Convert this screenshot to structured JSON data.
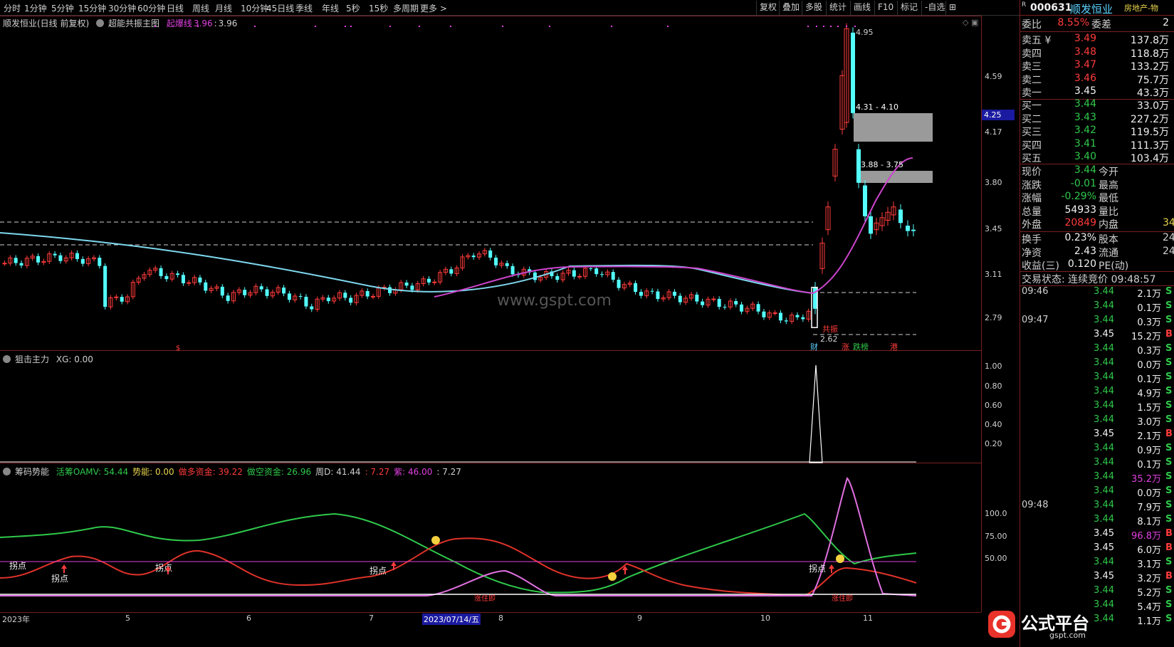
{
  "toolbar": {
    "timeframes": [
      "分时",
      "1分钟",
      "5分钟",
      "15分钟",
      "30分钟",
      "60分钟",
      "日线",
      "周线",
      "月线",
      "10分钟",
      "45日线",
      "季线",
      "年线",
      "5秒",
      "15秒",
      "多周期",
      "更多 >"
    ],
    "tools": [
      "复权",
      "叠加",
      "多股",
      "统计",
      "画线",
      "F10",
      "标记",
      "-自选",
      "⊞"
    ]
  },
  "main_panel": {
    "title": "顺发恒业(日线 前复权)",
    "indicator": "超能共振主图",
    "indicator_label": "起爆线",
    "indicator_value1": "3.96",
    "indicator_value2": "3.96",
    "y_ticks": [
      "4.59",
      "4.17",
      "3.80",
      "3.45",
      "3.11",
      "2.79"
    ],
    "price_tag": "4.25",
    "high_label": "4.95",
    "low_label": "2.62",
    "box1_label": "4.31 - 4.10",
    "box2_label": "3.88 - 3.75",
    "signal_label": "共振",
    "watermark": "www.gspt.com",
    "markers": [
      "财",
      "涨",
      "跌榜",
      "港"
    ],
    "dollar": "$"
  },
  "panel2": {
    "title": "狙击主力",
    "xg_label": "XG: 0.00",
    "y_ticks": [
      "1.00",
      "0.80",
      "0.60",
      "0.40",
      "0.20"
    ]
  },
  "panel3": {
    "title": "筹码势能",
    "items": [
      {
        "text": "活筹OAMV: 54.44",
        "color": "#2fc94b"
      },
      {
        "text": "势能: 0.00",
        "color": "#e8d44d"
      },
      {
        "text": "做多资金: 39.22",
        "color": "#ff3b3b"
      },
      {
        "text": "做空资金: 26.96",
        "color": "#2fc94b"
      },
      {
        "text": "周D: 41.44",
        "color": "#d0d0d0"
      },
      {
        "text": ": 7.27",
        "color": "#ff3b3b"
      },
      {
        "text": "紫: 46.00",
        "color": "#e040e0"
      },
      {
        "text": ": 7.27",
        "color": "#d0d0d0"
      }
    ],
    "y_ticks": [
      "100.0",
      "75.00",
      "50.00"
    ],
    "labels": [
      "拐点",
      "拐点",
      "拐点",
      "拐点",
      "拐点"
    ],
    "bottom_labels": [
      "涨住即",
      "涨住即"
    ]
  },
  "x_axis": {
    "labels": [
      "2023年",
      "5",
      "6",
      "7",
      "2023/07/14/五",
      "8",
      "9",
      "10",
      "11"
    ],
    "period": "日线"
  },
  "quote": {
    "code": "000631",
    "name": "顺发恒业",
    "sector": "房地产-物",
    "weibi_label": "委比",
    "weibi_value": "8.55%",
    "weicha_label": "委差",
    "weicha_value": "2",
    "asks": [
      {
        "label": "卖五 ¥",
        "price": "3.49",
        "vol": "137.8万"
      },
      {
        "label": "卖四",
        "price": "3.48",
        "vol": "118.8万"
      },
      {
        "label": "卖三",
        "price": "3.47",
        "vol": "133.2万"
      },
      {
        "label": "卖二",
        "price": "3.46",
        "vol": "75.7万"
      },
      {
        "label": "卖一",
        "price": "3.45",
        "vol": "43.3万"
      }
    ],
    "bids": [
      {
        "label": "买一",
        "price": "3.44",
        "vol": "33.0万"
      },
      {
        "label": "买二",
        "price": "3.43",
        "vol": "227.2万"
      },
      {
        "label": "买三",
        "price": "3.42",
        "vol": "119.5万"
      },
      {
        "label": "买四",
        "price": "3.41",
        "vol": "111.3万"
      },
      {
        "label": "买五",
        "price": "3.40",
        "vol": "103.4万"
      }
    ],
    "stats": [
      {
        "l1": "现价",
        "v1": "3.44",
        "l2": "今开",
        "v2": ""
      },
      {
        "l1": "涨跌",
        "v1": "-0.01",
        "l2": "最高",
        "v2": ""
      },
      {
        "l1": "涨幅",
        "v1": "-0.29%",
        "l2": "最低",
        "v2": ""
      },
      {
        "l1": "总量",
        "v1": "54933",
        "l2": "量比",
        "v2": ""
      },
      {
        "l1": "外盘",
        "v1": "20849",
        "l2": "内盘",
        "v2": "34"
      }
    ],
    "stats2": [
      {
        "l1": "换手",
        "v1": "0.23%",
        "l2": "股本",
        "v2": "24"
      },
      {
        "l1": "净资",
        "v1": "2.43",
        "l2": "流通",
        "v2": "24"
      },
      {
        "l1": "收益(三)",
        "v1": "0.120",
        "l2": "PE(动)",
        "v2": ""
      }
    ],
    "trade_status": "交易状态: 连续竞价 09:48:57",
    "ticks": [
      {
        "time": "09:46",
        "price": "3.44",
        "vol": "2.1万",
        "bs": "S"
      },
      {
        "time": "",
        "price": "3.44",
        "vol": "0.1万",
        "bs": "S"
      },
      {
        "time": "09:47",
        "price": "3.44",
        "vol": "0.3万",
        "bs": "S"
      },
      {
        "time": "",
        "price": "3.45",
        "vol": "15.2万",
        "bs": "B"
      },
      {
        "time": "",
        "price": "3.44",
        "vol": "0.3万",
        "bs": "S"
      },
      {
        "time": "",
        "price": "3.44",
        "vol": "0.0万",
        "bs": "S"
      },
      {
        "time": "",
        "price": "3.44",
        "vol": "0.1万",
        "bs": "S"
      },
      {
        "time": "",
        "price": "3.44",
        "vol": "4.9万",
        "bs": "S"
      },
      {
        "time": "",
        "price": "3.44",
        "vol": "1.5万",
        "bs": "S"
      },
      {
        "time": "",
        "price": "3.44",
        "vol": "3.0万",
        "bs": "S"
      },
      {
        "time": "",
        "price": "3.45",
        "vol": "2.1万",
        "bs": "B"
      },
      {
        "time": "",
        "price": "3.44",
        "vol": "0.9万",
        "bs": "S"
      },
      {
        "time": "",
        "price": "3.44",
        "vol": "0.1万",
        "bs": "S"
      },
      {
        "time": "",
        "price": "3.44",
        "vol": "35.2万",
        "bs": "S"
      },
      {
        "time": "",
        "price": "3.44",
        "vol": "0.0万",
        "bs": "S"
      },
      {
        "time": "09:48",
        "price": "3.44",
        "vol": "7.9万",
        "bs": "S"
      },
      {
        "time": "",
        "price": "3.44",
        "vol": "8.1万",
        "bs": "S"
      },
      {
        "time": "",
        "price": "3.45",
        "vol": "96.8万",
        "bs": "B"
      },
      {
        "time": "",
        "price": "3.45",
        "vol": "6.0万",
        "bs": "B"
      },
      {
        "time": "",
        "price": "3.44",
        "vol": "3.1万",
        "bs": "S"
      },
      {
        "time": "",
        "price": "3.45",
        "vol": "3.2万",
        "bs": "B"
      },
      {
        "time": "",
        "price": "3.44",
        "vol": "5.2万",
        "bs": "S"
      },
      {
        "time": "",
        "price": "3.44",
        "vol": "5.4万",
        "bs": "S"
      },
      {
        "time": "",
        "price": "3.44",
        "vol": "1.1万",
        "bs": "S"
      }
    ],
    "logo_text": "公式平台",
    "logo_url": "gspt.com"
  },
  "colors": {
    "up": "#ff3b3b",
    "down": "#54ffff",
    "ma": "#7fd8ee",
    "signal_line": "#cc44cc",
    "grid": "#7a1f1f",
    "bg": "#000000"
  }
}
